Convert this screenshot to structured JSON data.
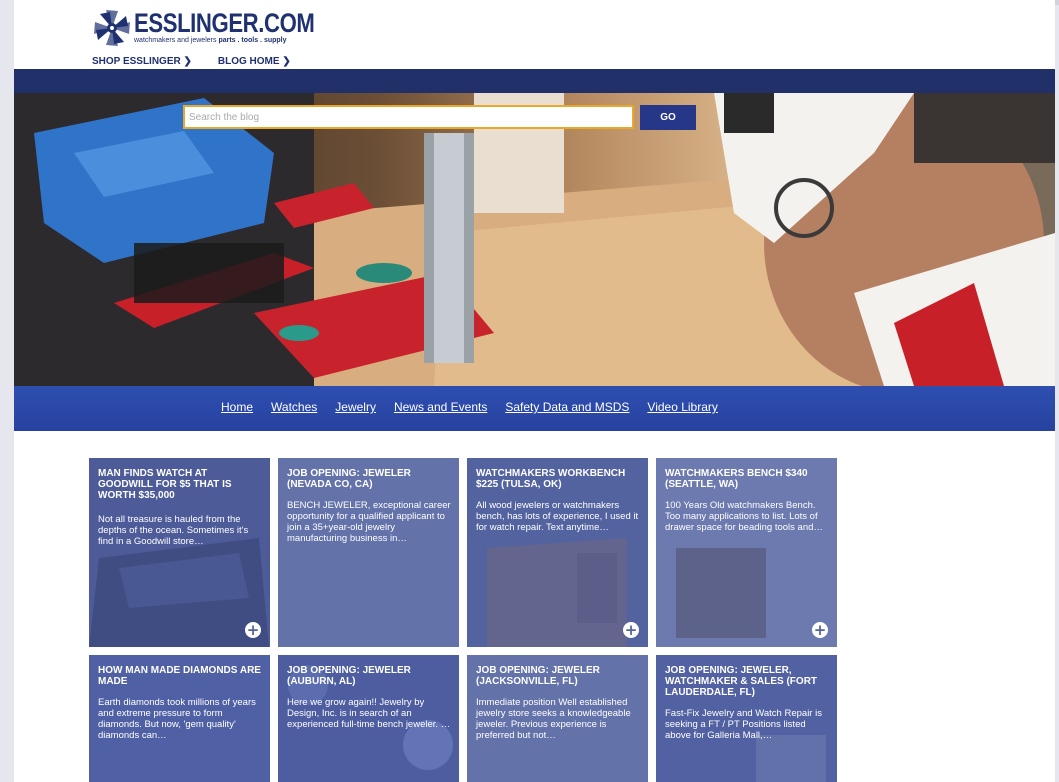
{
  "header": {
    "logo_name": "ESSLINGER.COM",
    "logo_tag_plain": "watchmakers and jewelers ",
    "logo_tag_bold": "parts . tools . supply",
    "links": [
      "SHOP ESSLINGER ❯",
      "BLOG HOME ❯"
    ]
  },
  "search": {
    "placeholder": "Search the blog",
    "button": "GO"
  },
  "nav": {
    "items": [
      "Home",
      "Watches",
      "Jewelry",
      "News and Events",
      "Safety Data and MSDS",
      "Video Library"
    ]
  },
  "cards": [
    {
      "title": "MAN FINDS WATCH AT GOODWILL FOR $5 THAT IS WORTH $35,000",
      "excerpt": "Not all treasure is hauled from the depths of the ocean. Sometimes it's find in a Goodwill store…",
      "has_plus": true
    },
    {
      "title": "JOB OPENING: JEWELER (NEVADA CO, CA)",
      "excerpt": "BENCH JEWELER, exceptional career opportunity for a qualified applicant to join a 35+year-old jewelry manufacturing business in…",
      "has_plus": false
    },
    {
      "title": "WATCHMAKERS WORKBENCH $225 (TULSA, OK)",
      "excerpt": "All wood jewelers or watchmakers bench, has lots of experience, I used it for watch repair. Text anytime…",
      "has_plus": true
    },
    {
      "title": "WATCHMAKERS BENCH $340 (SEATTLE, WA)",
      "excerpt": "100 Years Old watchmakers Bench. Too many applications to list. Lots of drawer space for beading tools and…",
      "has_plus": true
    },
    {
      "title": "HOW MAN MADE DIAMONDS ARE MADE",
      "excerpt": "Earth diamonds took millions of years and extreme pressure to form diamonds. But now, 'gem quality' diamonds can…",
      "has_plus": false
    },
    {
      "title": "JOB OPENING: JEWELER (AUBURN, AL)",
      "excerpt": "Here we grow again!! Jewelry by Design, Inc. is in search of an experienced full-time bench jeweler. …",
      "has_plus": false
    },
    {
      "title": "JOB OPENING: JEWELER (JACKSONVILLE, FL)",
      "excerpt": "Immediate position Well established jewelry store seeks a knowledgeable jeweler. Previous experience is preferred but not…",
      "has_plus": false
    },
    {
      "title": "JOB OPENING: JEWELER, WATCHMAKER & SALES (FORT LAUDERDALE, FL)",
      "excerpt": "Fast-Fix Jewelry and Watch Repair is seeking a FT / PT Positions listed above for Galleria Mall,…",
      "has_plus": false
    }
  ],
  "colors": {
    "brand_navy": "#1f3170",
    "nav_blue": "#2e4fb0",
    "card_tint": "#6271a8",
    "search_border": "#e8a82a"
  }
}
